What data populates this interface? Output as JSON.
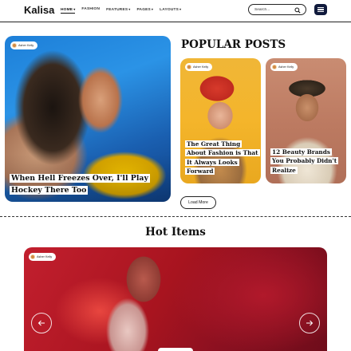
{
  "header": {
    "logo": "Kalisa",
    "nav": [
      {
        "label": "HOME",
        "has_caret": true,
        "active": true
      },
      {
        "label": "FASHION",
        "has_caret": false,
        "active": false
      },
      {
        "label": "FEATURES",
        "has_caret": true,
        "active": false
      },
      {
        "label": "PAGES",
        "has_caret": true,
        "active": false
      },
      {
        "label": "LAYOUTS",
        "has_caret": true,
        "active": false
      }
    ],
    "search_placeholder": "Search...",
    "search_icon": "search-icon",
    "menu_icon": "hamburger-icon"
  },
  "hero": {
    "author": "Asher Kelly",
    "title": "When Hell Freezes Over, I'll Play Hockey There Too"
  },
  "popular": {
    "title": "POPULAR POSTS",
    "posts": [
      {
        "author": "Asher Kelly",
        "title": "The Great Thing About Fashion is That It Always Looks Forward"
      },
      {
        "author": "Asher Kelly",
        "title": "12 Beauty Brands You Probably Didn't Realize"
      }
    ],
    "load_more": "Load More"
  },
  "hot_items": {
    "title": "Hot Items",
    "slide_author": "Asher Kelly",
    "prev_icon": "arrow-left-icon",
    "next_icon": "arrow-right-icon"
  },
  "colors": {
    "menu_button": "#101a3c",
    "hero_blue": "#1d7fd8",
    "card_yellow": "#f0b637",
    "card_tan": "#c98c72",
    "hot_red": "#c21f2e"
  }
}
